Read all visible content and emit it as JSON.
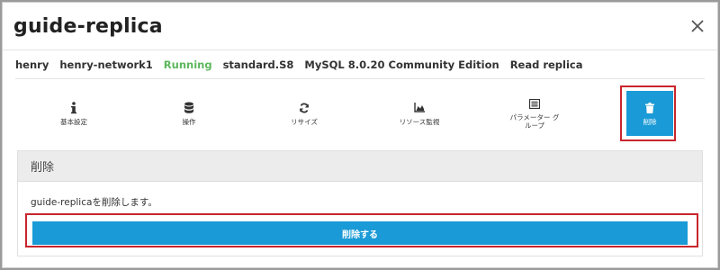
{
  "modal": {
    "title": "guide-replica",
    "close_icon": "close-icon"
  },
  "info": {
    "user": "henry",
    "network": "henry-network1",
    "status": "Running",
    "plan": "standard.S8",
    "engine": "MySQL 8.0.20 Community Edition",
    "role": "Read replica"
  },
  "colors": {
    "accent": "#1a9ad6",
    "status_running": "#5cb85c",
    "highlight": "#c9252c"
  },
  "tabs": [
    {
      "label": "基本設定",
      "icon": "info-icon"
    },
    {
      "label": "操作",
      "icon": "database-icon"
    },
    {
      "label": "リサイズ",
      "icon": "refresh-icon"
    },
    {
      "label": "リソース監視",
      "icon": "area-chart-icon"
    },
    {
      "label": "パラメーター グループ",
      "icon": "list-icon"
    },
    {
      "label": "削除",
      "icon": "trash-icon",
      "active": true
    }
  ],
  "panel": {
    "heading": "削除",
    "message": "guide-replicaを削除します。",
    "button_label": "削除する"
  }
}
